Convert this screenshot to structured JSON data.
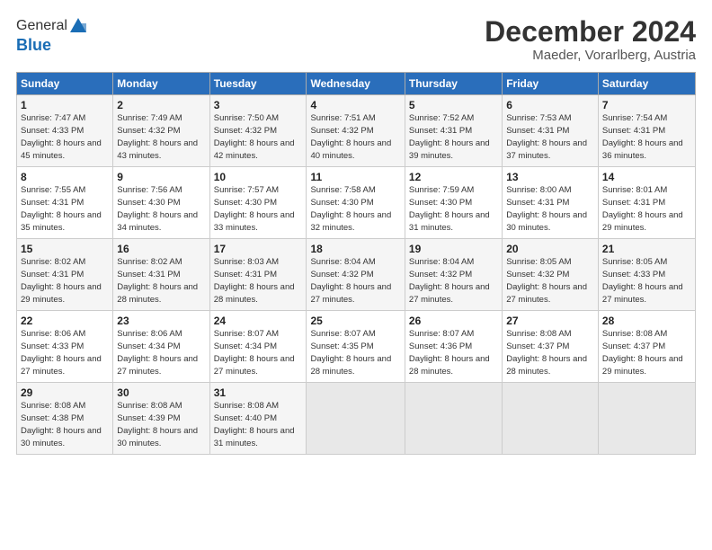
{
  "logo": {
    "general": "General",
    "blue": "Blue"
  },
  "title": "December 2024",
  "subtitle": "Maeder, Vorarlberg, Austria",
  "header_days": [
    "Sunday",
    "Monday",
    "Tuesday",
    "Wednesday",
    "Thursday",
    "Friday",
    "Saturday"
  ],
  "weeks": [
    [
      {
        "day": "1",
        "sunrise": "7:47 AM",
        "sunset": "4:33 PM",
        "daylight": "8 hours and 45 minutes."
      },
      {
        "day": "2",
        "sunrise": "7:49 AM",
        "sunset": "4:32 PM",
        "daylight": "8 hours and 43 minutes."
      },
      {
        "day": "3",
        "sunrise": "7:50 AM",
        "sunset": "4:32 PM",
        "daylight": "8 hours and 42 minutes."
      },
      {
        "day": "4",
        "sunrise": "7:51 AM",
        "sunset": "4:32 PM",
        "daylight": "8 hours and 40 minutes."
      },
      {
        "day": "5",
        "sunrise": "7:52 AM",
        "sunset": "4:31 PM",
        "daylight": "8 hours and 39 minutes."
      },
      {
        "day": "6",
        "sunrise": "7:53 AM",
        "sunset": "4:31 PM",
        "daylight": "8 hours and 37 minutes."
      },
      {
        "day": "7",
        "sunrise": "7:54 AM",
        "sunset": "4:31 PM",
        "daylight": "8 hours and 36 minutes."
      }
    ],
    [
      {
        "day": "8",
        "sunrise": "7:55 AM",
        "sunset": "4:31 PM",
        "daylight": "8 hours and 35 minutes."
      },
      {
        "day": "9",
        "sunrise": "7:56 AM",
        "sunset": "4:30 PM",
        "daylight": "8 hours and 34 minutes."
      },
      {
        "day": "10",
        "sunrise": "7:57 AM",
        "sunset": "4:30 PM",
        "daylight": "8 hours and 33 minutes."
      },
      {
        "day": "11",
        "sunrise": "7:58 AM",
        "sunset": "4:30 PM",
        "daylight": "8 hours and 32 minutes."
      },
      {
        "day": "12",
        "sunrise": "7:59 AM",
        "sunset": "4:30 PM",
        "daylight": "8 hours and 31 minutes."
      },
      {
        "day": "13",
        "sunrise": "8:00 AM",
        "sunset": "4:31 PM",
        "daylight": "8 hours and 30 minutes."
      },
      {
        "day": "14",
        "sunrise": "8:01 AM",
        "sunset": "4:31 PM",
        "daylight": "8 hours and 29 minutes."
      }
    ],
    [
      {
        "day": "15",
        "sunrise": "8:02 AM",
        "sunset": "4:31 PM",
        "daylight": "8 hours and 29 minutes."
      },
      {
        "day": "16",
        "sunrise": "8:02 AM",
        "sunset": "4:31 PM",
        "daylight": "8 hours and 28 minutes."
      },
      {
        "day": "17",
        "sunrise": "8:03 AM",
        "sunset": "4:31 PM",
        "daylight": "8 hours and 28 minutes."
      },
      {
        "day": "18",
        "sunrise": "8:04 AM",
        "sunset": "4:32 PM",
        "daylight": "8 hours and 27 minutes."
      },
      {
        "day": "19",
        "sunrise": "8:04 AM",
        "sunset": "4:32 PM",
        "daylight": "8 hours and 27 minutes."
      },
      {
        "day": "20",
        "sunrise": "8:05 AM",
        "sunset": "4:32 PM",
        "daylight": "8 hours and 27 minutes."
      },
      {
        "day": "21",
        "sunrise": "8:05 AM",
        "sunset": "4:33 PM",
        "daylight": "8 hours and 27 minutes."
      }
    ],
    [
      {
        "day": "22",
        "sunrise": "8:06 AM",
        "sunset": "4:33 PM",
        "daylight": "8 hours and 27 minutes."
      },
      {
        "day": "23",
        "sunrise": "8:06 AM",
        "sunset": "4:34 PM",
        "daylight": "8 hours and 27 minutes."
      },
      {
        "day": "24",
        "sunrise": "8:07 AM",
        "sunset": "4:34 PM",
        "daylight": "8 hours and 27 minutes."
      },
      {
        "day": "25",
        "sunrise": "8:07 AM",
        "sunset": "4:35 PM",
        "daylight": "8 hours and 28 minutes."
      },
      {
        "day": "26",
        "sunrise": "8:07 AM",
        "sunset": "4:36 PM",
        "daylight": "8 hours and 28 minutes."
      },
      {
        "day": "27",
        "sunrise": "8:08 AM",
        "sunset": "4:37 PM",
        "daylight": "8 hours and 28 minutes."
      },
      {
        "day": "28",
        "sunrise": "8:08 AM",
        "sunset": "4:37 PM",
        "daylight": "8 hours and 29 minutes."
      }
    ],
    [
      {
        "day": "29",
        "sunrise": "8:08 AM",
        "sunset": "4:38 PM",
        "daylight": "8 hours and 30 minutes."
      },
      {
        "day": "30",
        "sunrise": "8:08 AM",
        "sunset": "4:39 PM",
        "daylight": "8 hours and 30 minutes."
      },
      {
        "day": "31",
        "sunrise": "8:08 AM",
        "sunset": "4:40 PM",
        "daylight": "8 hours and 31 minutes."
      },
      null,
      null,
      null,
      null
    ]
  ]
}
